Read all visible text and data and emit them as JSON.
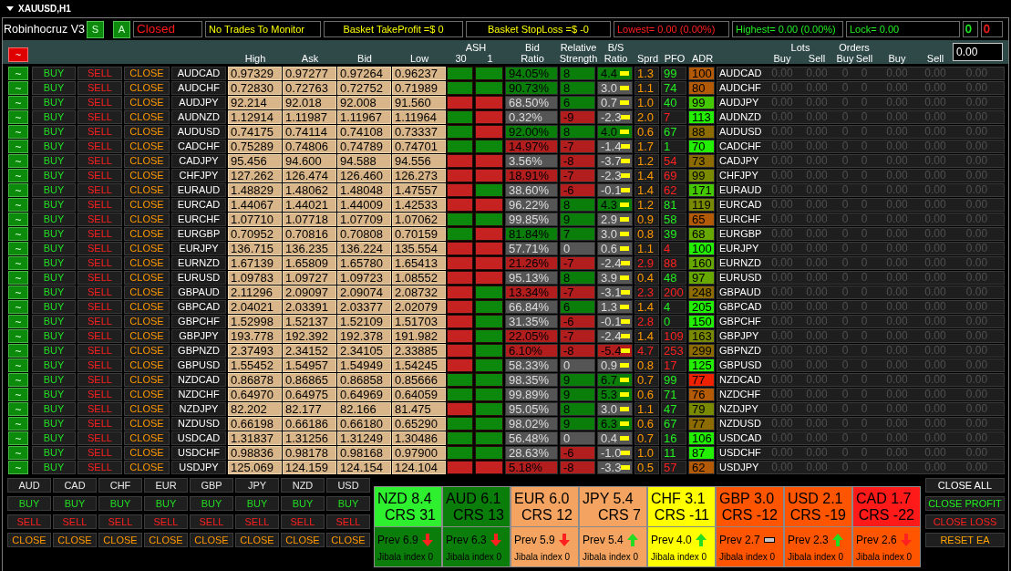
{
  "window": {
    "title": "XAUUSD,H1"
  },
  "header": {
    "title": "Robinhocruz V3",
    "mode_buttons": [
      {
        "label": "S"
      },
      {
        "label": "A"
      }
    ],
    "info": [
      {
        "kind": "status",
        "text": "Closed",
        "color": "#ff1a1a"
      },
      {
        "kind": "notice",
        "text": "No Trades To Monitor",
        "color": "#ffff00"
      },
      {
        "kind": "basket",
        "text": "Basket TakeProfit =$ 0",
        "color": "#ffff00"
      },
      {
        "kind": "basket",
        "text": "Basket StopLoss =$ -0",
        "color": "#ffff00"
      },
      {
        "kind": "stat",
        "text": "Lowest= 0.00 (0.00%)",
        "color": "#ff2020"
      },
      {
        "kind": "stat",
        "text": "Highest= 0.00 (0.00%)",
        "color": "#22ee22"
      },
      {
        "kind": "stat",
        "text": "Lock= 0.00",
        "color": "#22ee22"
      },
      {
        "kind": "counter",
        "text": "0",
        "color": "#22ee22"
      },
      {
        "kind": "counter",
        "text": "0",
        "color": "#ff2020"
      }
    ]
  },
  "columns": {
    "chart_toggle": "~",
    "high": "High",
    "ask": "Ask",
    "bid": "Bid",
    "low": "Low",
    "ash": {
      "label": "ASH",
      "periods": [
        "30",
        "1"
      ]
    },
    "bid_ratio": "Bid Ratio",
    "relative_strength": "Relative Strength",
    "bs_ratio": "B/S Ratio",
    "spread": "Sprd",
    "pfo": "PFO",
    "adr": "ADR",
    "lots": {
      "label": "Lots",
      "buy": "Buy",
      "sell": "Sell"
    },
    "orders": {
      "label": "Orders",
      "buy": "Buy",
      "sell": "Sell"
    },
    "buy": "Buy",
    "sell": "Sell",
    "input": {
      "value": "0.00"
    }
  },
  "rows": [
    {
      "chart": "~",
      "buy": "BUY",
      "sell": "SELL",
      "close": "CLOSE",
      "symbol": "AUDCAD",
      "high": "0.97329",
      "ask": "0.97277",
      "bid": "0.97264",
      "low": "0.96237",
      "ash_30": {
        "color": "#0c880c"
      },
      "ash_1": {
        "color": "#0c880c"
      },
      "bid_ratio": {
        "text": "94.05%",
        "color": "#0b7d0b"
      },
      "relative_strength": {
        "text": "8",
        "color": "#0b7d0b"
      },
      "bs_ratio": {
        "text": "4.4",
        "color": "#0b7d0b"
      },
      "spread": {
        "text": "1.3",
        "kind": "normal"
      },
      "pfo": {
        "text": "99",
        "kind": "positive"
      },
      "adr": {
        "text": "100",
        "color": "#b35a06"
      },
      "symbol_2": "AUDCAD",
      "positions": [
        "0.00",
        "0.00",
        "0",
        "0",
        "0.00",
        "0.00",
        "0.00"
      ]
    },
    {
      "chart": "~",
      "buy": "BUY",
      "sell": "SELL",
      "close": "CLOSE",
      "symbol": "AUDCHF",
      "high": "0.72830",
      "ask": "0.72763",
      "bid": "0.72752",
      "low": "0.71989",
      "ash_30": {
        "color": "#0c880c"
      },
      "ash_1": {
        "color": "#0c880c"
      },
      "bid_ratio": {
        "text": "90.73%",
        "color": "#0b7d0b"
      },
      "relative_strength": {
        "text": "8",
        "color": "#0b7d0b"
      },
      "bs_ratio": {
        "text": "3.0",
        "color": "#555555"
      },
      "spread": {
        "text": "1.1",
        "kind": "normal"
      },
      "pfo": {
        "text": "74",
        "kind": "positive"
      },
      "adr": {
        "text": "80",
        "color": "#b35a06"
      },
      "symbol_2": "AUDCHF",
      "positions": [
        "0.00",
        "0.00",
        "0",
        "0",
        "0.00",
        "0.00",
        "0.00"
      ]
    },
    {
      "chart": "~",
      "buy": "BUY",
      "sell": "SELL",
      "close": "CLOSE",
      "symbol": "AUDJPY",
      "high": "92.214",
      "ask": "92.018",
      "bid": "92.008",
      "low": "91.560",
      "ash_30": {
        "color": "#c62222"
      },
      "ash_1": {
        "color": "#c62222"
      },
      "bid_ratio": {
        "text": "68.50%",
        "color": "#555555"
      },
      "relative_strength": {
        "text": "6",
        "color": "#0b7d0b"
      },
      "bs_ratio": {
        "text": "0.7",
        "color": "#555555"
      },
      "spread": {
        "text": "1.0",
        "kind": "normal"
      },
      "pfo": {
        "text": "40",
        "kind": "positive"
      },
      "adr": {
        "text": "99",
        "color": "#44c800"
      },
      "symbol_2": "AUDJPY",
      "positions": [
        "0.00",
        "0.00",
        "0",
        "0",
        "0.00",
        "0.00",
        "0.00"
      ]
    },
    {
      "chart": "~",
      "buy": "BUY",
      "sell": "SELL",
      "close": "CLOSE",
      "symbol": "AUDNZD",
      "high": "1.12914",
      "ask": "1.11987",
      "bid": "1.11967",
      "low": "1.11964",
      "ash_30": {
        "color": "#0c880c"
      },
      "ash_1": {
        "color": "#c62222"
      },
      "bid_ratio": {
        "text": "0.32%",
        "color": "#555555"
      },
      "relative_strength": {
        "text": "-9",
        "color": "#b21e1e"
      },
      "bs_ratio": {
        "text": "-2.3",
        "color": "#555555"
      },
      "spread": {
        "text": "2.0",
        "kind": "normal"
      },
      "pfo": {
        "text": "7",
        "kind": "negative"
      },
      "adr": {
        "text": "113",
        "color": "#22f000"
      },
      "symbol_2": "AUDNZD",
      "positions": [
        "0.00",
        "0.00",
        "0",
        "0",
        "0.00",
        "0.00",
        "0.00"
      ]
    },
    {
      "chart": "~",
      "buy": "BUY",
      "sell": "SELL",
      "close": "CLOSE",
      "symbol": "AUDUSD",
      "high": "0.74175",
      "ask": "0.74114",
      "bid": "0.74108",
      "low": "0.73337",
      "ash_30": {
        "color": "#0c880c"
      },
      "ash_1": {
        "color": "#c62222"
      },
      "bid_ratio": {
        "text": "92.00%",
        "color": "#0b7d0b"
      },
      "relative_strength": {
        "text": "8",
        "color": "#0b7d0b"
      },
      "bs_ratio": {
        "text": "4.0",
        "color": "#0b7d0b"
      },
      "spread": {
        "text": "0.6",
        "kind": "normal"
      },
      "pfo": {
        "text": "67",
        "kind": "positive"
      },
      "adr": {
        "text": "88",
        "color": "#8c6c00"
      },
      "symbol_2": "AUDUSD",
      "positions": [
        "0.00",
        "0.00",
        "0",
        "0",
        "0.00",
        "0.00",
        "0.00"
      ]
    },
    {
      "chart": "~",
      "buy": "BUY",
      "sell": "SELL",
      "close": "CLOSE",
      "symbol": "CADCHF",
      "high": "0.75289",
      "ask": "0.74806",
      "bid": "0.74789",
      "low": "0.74701",
      "ash_30": {
        "color": "#0c880c"
      },
      "ash_1": {
        "color": "#0c880c"
      },
      "bid_ratio": {
        "text": "14.97%",
        "color": "#b21e1e"
      },
      "relative_strength": {
        "text": "-7",
        "color": "#b21e1e"
      },
      "bs_ratio": {
        "text": "-1.4",
        "color": "#555555"
      },
      "spread": {
        "text": "1.7",
        "kind": "normal"
      },
      "pfo": {
        "text": "1",
        "kind": "positive"
      },
      "adr": {
        "text": "70",
        "color": "#22f000"
      },
      "symbol_2": "CADCHF",
      "positions": [
        "0.00",
        "0.00",
        "0",
        "0",
        "0.00",
        "0.00",
        "0.00"
      ]
    },
    {
      "chart": "~",
      "buy": "BUY",
      "sell": "SELL",
      "close": "CLOSE",
      "symbol": "CADJPY",
      "high": "95.456",
      "ask": "94.600",
      "bid": "94.588",
      "low": "94.556",
      "ash_30": {
        "color": "#c62222"
      },
      "ash_1": {
        "color": "#c62222"
      },
      "bid_ratio": {
        "text": "3.56%",
        "color": "#555555"
      },
      "relative_strength": {
        "text": "-8",
        "color": "#b21e1e"
      },
      "bs_ratio": {
        "text": "-3.7",
        "color": "#555555"
      },
      "spread": {
        "text": "1.2",
        "kind": "normal"
      },
      "pfo": {
        "text": "54",
        "kind": "negative"
      },
      "adr": {
        "text": "73",
        "color": "#8c6c00"
      },
      "symbol_2": "CADJPY",
      "positions": [
        "0.00",
        "0.00",
        "0",
        "0",
        "0.00",
        "0.00",
        "0.00"
      ]
    },
    {
      "chart": "~",
      "buy": "BUY",
      "sell": "SELL",
      "close": "CLOSE",
      "symbol": "CHFJPY",
      "high": "127.262",
      "ask": "126.474",
      "bid": "126.460",
      "low": "126.273",
      "ash_30": {
        "color": "#c62222"
      },
      "ash_1": {
        "color": "#c62222"
      },
      "bid_ratio": {
        "text": "18.91%",
        "color": "#b21e1e"
      },
      "relative_strength": {
        "text": "-7",
        "color": "#b21e1e"
      },
      "bs_ratio": {
        "text": "-2.3",
        "color": "#555555"
      },
      "spread": {
        "text": "1.4",
        "kind": "normal"
      },
      "pfo": {
        "text": "69",
        "kind": "negative"
      },
      "adr": {
        "text": "99",
        "color": "#7a8a00"
      },
      "symbol_2": "CHFJPY",
      "positions": [
        "0.00",
        "0.00",
        "0",
        "0",
        "0.00",
        "0.00",
        "0.00"
      ]
    },
    {
      "chart": "~",
      "buy": "BUY",
      "sell": "SELL",
      "close": "CLOSE",
      "symbol": "EURAUD",
      "high": "1.48829",
      "ask": "1.48062",
      "bid": "1.48048",
      "low": "1.47557",
      "ash_30": {
        "color": "#c62222"
      },
      "ash_1": {
        "color": "#0c880c"
      },
      "bid_ratio": {
        "text": "38.60%",
        "color": "#555555"
      },
      "relative_strength": {
        "text": "-6",
        "color": "#b21e1e"
      },
      "bs_ratio": {
        "text": "-0.1",
        "color": "#555555"
      },
      "spread": {
        "text": "1.4",
        "kind": "normal"
      },
      "pfo": {
        "text": "62",
        "kind": "negative"
      },
      "adr": {
        "text": "171",
        "color": "#44c800"
      },
      "symbol_2": "EURAUD",
      "positions": [
        "0.00",
        "0.00",
        "0",
        "0",
        "0.00",
        "0.00",
        "0.00"
      ]
    },
    {
      "chart": "~",
      "buy": "BUY",
      "sell": "SELL",
      "close": "CLOSE",
      "symbol": "EURCAD",
      "high": "1.44067",
      "ask": "1.44021",
      "bid": "1.44009",
      "low": "1.42533",
      "ash_30": {
        "color": "#c62222"
      },
      "ash_1": {
        "color": "#c62222"
      },
      "bid_ratio": {
        "text": "96.22%",
        "color": "#555555"
      },
      "relative_strength": {
        "text": "8",
        "color": "#0b7d0b"
      },
      "bs_ratio": {
        "text": "4.3",
        "color": "#0b7d0b"
      },
      "spread": {
        "text": "1.2",
        "kind": "normal"
      },
      "pfo": {
        "text": "81",
        "kind": "positive"
      },
      "adr": {
        "text": "119",
        "color": "#7a8a00"
      },
      "symbol_2": "EURCAD",
      "positions": [
        "0.00",
        "0.00",
        "0",
        "0",
        "0.00",
        "0.00",
        "0.00"
      ]
    },
    {
      "chart": "~",
      "buy": "BUY",
      "sell": "SELL",
      "close": "CLOSE",
      "symbol": "EURCHF",
      "high": "1.07710",
      "ask": "1.07718",
      "bid": "1.07709",
      "low": "1.07062",
      "ash_30": {
        "color": "#0c880c"
      },
      "ash_1": {
        "color": "#0c880c"
      },
      "bid_ratio": {
        "text": "99.85%",
        "color": "#555555"
      },
      "relative_strength": {
        "text": "9",
        "color": "#0b7d0b"
      },
      "bs_ratio": {
        "text": "2.9",
        "color": "#555555"
      },
      "spread": {
        "text": "0.9",
        "kind": "normal"
      },
      "pfo": {
        "text": "58",
        "kind": "positive"
      },
      "adr": {
        "text": "65",
        "color": "#b35a06"
      },
      "symbol_2": "EURCHF",
      "positions": [
        "0.00",
        "0.00",
        "0",
        "0",
        "0.00",
        "0.00",
        "0.00"
      ]
    },
    {
      "chart": "~",
      "buy": "BUY",
      "sell": "SELL",
      "close": "CLOSE",
      "symbol": "EURGBP",
      "high": "0.70952",
      "ask": "0.70816",
      "bid": "0.70808",
      "low": "0.70159",
      "ash_30": {
        "color": "#0c880c"
      },
      "ash_1": {
        "color": "#c62222"
      },
      "bid_ratio": {
        "text": "81.84%",
        "color": "#0b7d0b"
      },
      "relative_strength": {
        "text": "7",
        "color": "#0b7d0b"
      },
      "bs_ratio": {
        "text": "3.0",
        "color": "#555555"
      },
      "spread": {
        "text": "0.8",
        "kind": "normal"
      },
      "pfo": {
        "text": "39",
        "kind": "positive"
      },
      "adr": {
        "text": "68",
        "color": "#66a800"
      },
      "symbol_2": "EURGBP",
      "positions": [
        "0.00",
        "0.00",
        "0",
        "0",
        "0.00",
        "0.00",
        "0.00"
      ]
    },
    {
      "chart": "~",
      "buy": "BUY",
      "sell": "SELL",
      "close": "CLOSE",
      "symbol": "EURJPY",
      "high": "136.715",
      "ask": "136.235",
      "bid": "136.224",
      "low": "135.554",
      "ash_30": {
        "color": "#c62222"
      },
      "ash_1": {
        "color": "#c62222"
      },
      "bid_ratio": {
        "text": "57.71%",
        "color": "#555555"
      },
      "relative_strength": {
        "text": "0",
        "color": "#555555"
      },
      "bs_ratio": {
        "text": "0.6",
        "color": "#555555"
      },
      "spread": {
        "text": "1.1",
        "kind": "normal"
      },
      "pfo": {
        "text": "4",
        "kind": "negative"
      },
      "adr": {
        "text": "100",
        "color": "#22f000"
      },
      "symbol_2": "EURJPY",
      "positions": [
        "0.00",
        "0.00",
        "0",
        "0",
        "0.00",
        "0.00",
        "0.00"
      ]
    },
    {
      "chart": "~",
      "buy": "BUY",
      "sell": "SELL",
      "close": "CLOSE",
      "symbol": "EURNZD",
      "high": "1.67139",
      "ask": "1.65809",
      "bid": "1.65780",
      "low": "1.65413",
      "ash_30": {
        "color": "#c62222"
      },
      "ash_1": {
        "color": "#c62222"
      },
      "bid_ratio": {
        "text": "21.26%",
        "color": "#b21e1e"
      },
      "relative_strength": {
        "text": "-7",
        "color": "#b21e1e"
      },
      "bs_ratio": {
        "text": "-2.4",
        "color": "#555555"
      },
      "spread": {
        "text": "2.9",
        "kind": "wide"
      },
      "pfo": {
        "text": "88",
        "kind": "negative"
      },
      "adr": {
        "text": "160",
        "color": "#66a800"
      },
      "symbol_2": "EURNZD",
      "positions": [
        "0.00",
        "0.00",
        "0",
        "0",
        "0.00",
        "0.00",
        "0.00"
      ]
    },
    {
      "chart": "~",
      "buy": "BUY",
      "sell": "SELL",
      "close": "CLOSE",
      "symbol": "EURUSD",
      "high": "1.09783",
      "ask": "1.09727",
      "bid": "1.09723",
      "low": "1.08552",
      "ash_30": {
        "color": "#c62222"
      },
      "ash_1": {
        "color": "#c62222"
      },
      "bid_ratio": {
        "text": "95.13%",
        "color": "#555555"
      },
      "relative_strength": {
        "text": "8",
        "color": "#0b7d0b"
      },
      "bs_ratio": {
        "text": "3.9",
        "color": "#555555"
      },
      "spread": {
        "text": "0.4",
        "kind": "normal"
      },
      "pfo": {
        "text": "48",
        "kind": "positive"
      },
      "adr": {
        "text": "97",
        "color": "#66a800"
      },
      "symbol_2": "EURUSD",
      "positions": [
        "0.00",
        "0.00",
        "0",
        "0",
        "0.00",
        "0.00",
        "0.00"
      ]
    },
    {
      "chart": "~",
      "buy": "BUY",
      "sell": "SELL",
      "close": "CLOSE",
      "symbol": "GBPAUD",
      "high": "2.11296",
      "ask": "2.09097",
      "bid": "2.09074",
      "low": "2.08732",
      "ash_30": {
        "color": "#c62222"
      },
      "ash_1": {
        "color": "#0c880c"
      },
      "bid_ratio": {
        "text": "13.34%",
        "color": "#b21e1e"
      },
      "relative_strength": {
        "text": "-7",
        "color": "#b21e1e"
      },
      "bs_ratio": {
        "text": "-3.1",
        "color": "#555555"
      },
      "spread": {
        "text": "2.3",
        "kind": "wide"
      },
      "pfo": {
        "text": "200",
        "kind": "negative"
      },
      "adr": {
        "text": "248",
        "color": "#8c6c00"
      },
      "symbol_2": "GBPAUD",
      "positions": [
        "0.00",
        "0.00",
        "0",
        "0",
        "0.00",
        "0.00",
        "0.00"
      ]
    },
    {
      "chart": "~",
      "buy": "BUY",
      "sell": "SELL",
      "close": "CLOSE",
      "symbol": "GBPCAD",
      "high": "2.04021",
      "ask": "2.03391",
      "bid": "2.03377",
      "low": "2.02079",
      "ash_30": {
        "color": "#c62222"
      },
      "ash_1": {
        "color": "#0c880c"
      },
      "bid_ratio": {
        "text": "66.84%",
        "color": "#555555"
      },
      "relative_strength": {
        "text": "6",
        "color": "#0b7d0b"
      },
      "bs_ratio": {
        "text": "1.3",
        "color": "#555555"
      },
      "spread": {
        "text": "1.4",
        "kind": "normal"
      },
      "pfo": {
        "text": "4",
        "kind": "positive"
      },
      "adr": {
        "text": "205",
        "color": "#22f000"
      },
      "symbol_2": "GBPCAD",
      "positions": [
        "0.00",
        "0.00",
        "0",
        "0",
        "0.00",
        "0.00",
        "0.00"
      ]
    },
    {
      "chart": "~",
      "buy": "BUY",
      "sell": "SELL",
      "close": "CLOSE",
      "symbol": "GBPCHF",
      "high": "1.52998",
      "ask": "1.52137",
      "bid": "1.52109",
      "low": "1.51703",
      "ash_30": {
        "color": "#c62222"
      },
      "ash_1": {
        "color": "#0c880c"
      },
      "bid_ratio": {
        "text": "31.35%",
        "color": "#555555"
      },
      "relative_strength": {
        "text": "-6",
        "color": "#b21e1e"
      },
      "bs_ratio": {
        "text": "-0.1",
        "color": "#555555"
      },
      "spread": {
        "text": "2.8",
        "kind": "wide"
      },
      "pfo": {
        "text": "0",
        "kind": "positive"
      },
      "adr": {
        "text": "150",
        "color": "#22f000"
      },
      "symbol_2": "GBPCHF",
      "positions": [
        "0.00",
        "0.00",
        "0",
        "0",
        "0.00",
        "0.00",
        "0.00"
      ]
    },
    {
      "chart": "~",
      "buy": "BUY",
      "sell": "SELL",
      "close": "CLOSE",
      "symbol": "GBPJPY",
      "high": "193.778",
      "ask": "192.392",
      "bid": "192.378",
      "low": "191.982",
      "ash_30": {
        "color": "#c62222"
      },
      "ash_1": {
        "color": "#0c880c"
      },
      "bid_ratio": {
        "text": "22.05%",
        "color": "#b21e1e"
      },
      "relative_strength": {
        "text": "-7",
        "color": "#b21e1e"
      },
      "bs_ratio": {
        "text": "-2.4",
        "color": "#555555"
      },
      "spread": {
        "text": "1.4",
        "kind": "normal"
      },
      "pfo": {
        "text": "109",
        "kind": "negative"
      },
      "adr": {
        "text": "163",
        "color": "#7a8a00"
      },
      "symbol_2": "GBPJPY",
      "positions": [
        "0.00",
        "0.00",
        "0",
        "0",
        "0.00",
        "0.00",
        "0.00"
      ]
    },
    {
      "chart": "~",
      "buy": "BUY",
      "sell": "SELL",
      "close": "CLOSE",
      "symbol": "GBPNZD",
      "high": "2.37493",
      "ask": "2.34152",
      "bid": "2.34105",
      "low": "2.33885",
      "ash_30": {
        "color": "#c62222"
      },
      "ash_1": {
        "color": "#0c880c"
      },
      "bid_ratio": {
        "text": "6.10%",
        "color": "#b21e1e"
      },
      "relative_strength": {
        "text": "-8",
        "color": "#b21e1e"
      },
      "bs_ratio": {
        "text": "-5.4",
        "color": "#b21e1e"
      },
      "spread": {
        "text": "4.7",
        "kind": "wide"
      },
      "pfo": {
        "text": "253",
        "kind": "negative"
      },
      "adr": {
        "text": "299",
        "color": "#8c6c00"
      },
      "symbol_2": "GBPNZD",
      "positions": [
        "0.00",
        "0.00",
        "0",
        "0",
        "0.00",
        "0.00",
        "0.00"
      ]
    },
    {
      "chart": "~",
      "buy": "BUY",
      "sell": "SELL",
      "close": "CLOSE",
      "symbol": "GBPUSD",
      "high": "1.55452",
      "ask": "1.54957",
      "bid": "1.54949",
      "low": "1.54245",
      "ash_30": {
        "color": "#c62222"
      },
      "ash_1": {
        "color": "#0c880c"
      },
      "bid_ratio": {
        "text": "58.33%",
        "color": "#555555"
      },
      "relative_strength": {
        "text": "0",
        "color": "#555555"
      },
      "bs_ratio": {
        "text": "0.9",
        "color": "#555555"
      },
      "spread": {
        "text": "0.8",
        "kind": "normal"
      },
      "pfo": {
        "text": "17",
        "kind": "negative"
      },
      "adr": {
        "text": "125",
        "color": "#22f000"
      },
      "symbol_2": "GBPUSD",
      "positions": [
        "0.00",
        "0.00",
        "0",
        "0",
        "0.00",
        "0.00",
        "0.00"
      ]
    },
    {
      "chart": "~",
      "buy": "BUY",
      "sell": "SELL",
      "close": "CLOSE",
      "symbol": "NZDCAD",
      "high": "0.86878",
      "ask": "0.86865",
      "bid": "0.86858",
      "low": "0.85666",
      "ash_30": {
        "color": "#0c880c"
      },
      "ash_1": {
        "color": "#0c880c"
      },
      "bid_ratio": {
        "text": "98.35%",
        "color": "#555555"
      },
      "relative_strength": {
        "text": "9",
        "color": "#0b7d0b"
      },
      "bs_ratio": {
        "text": "6.7",
        "color": "#0b7d0b"
      },
      "spread": {
        "text": "0.7",
        "kind": "normal"
      },
      "pfo": {
        "text": "99",
        "kind": "positive"
      },
      "adr": {
        "text": "77",
        "color": "#ee2200"
      },
      "symbol_2": "NZDCAD",
      "positions": [
        "0.00",
        "0.00",
        "0",
        "0",
        "0.00",
        "0.00",
        "0.00"
      ]
    },
    {
      "chart": "~",
      "buy": "BUY",
      "sell": "SELL",
      "close": "CLOSE",
      "symbol": "NZDCHF",
      "high": "0.64970",
      "ask": "0.64975",
      "bid": "0.64969",
      "low": "0.64059",
      "ash_30": {
        "color": "#0c880c"
      },
      "ash_1": {
        "color": "#0c880c"
      },
      "bid_ratio": {
        "text": "99.89%",
        "color": "#555555"
      },
      "relative_strength": {
        "text": "9",
        "color": "#0b7d0b"
      },
      "bs_ratio": {
        "text": "5.3",
        "color": "#0b7d0b"
      },
      "spread": {
        "text": "0.6",
        "kind": "normal"
      },
      "pfo": {
        "text": "71",
        "kind": "positive"
      },
      "adr": {
        "text": "76",
        "color": "#b35a06"
      },
      "symbol_2": "NZDCHF",
      "positions": [
        "0.00",
        "0.00",
        "0",
        "0",
        "0.00",
        "0.00",
        "0.00"
      ]
    },
    {
      "chart": "~",
      "buy": "BUY",
      "sell": "SELL",
      "close": "CLOSE",
      "symbol": "NZDJPY",
      "high": "82.202",
      "ask": "82.177",
      "bid": "82.166",
      "low": "81.475",
      "ash_30": {
        "color": "#c62222"
      },
      "ash_1": {
        "color": "#0c880c"
      },
      "bid_ratio": {
        "text": "95.05%",
        "color": "#555555"
      },
      "relative_strength": {
        "text": "8",
        "color": "#0b7d0b"
      },
      "bs_ratio": {
        "text": "3.0",
        "color": "#555555"
      },
      "spread": {
        "text": "1.1",
        "kind": "normal"
      },
      "pfo": {
        "text": "47",
        "kind": "positive"
      },
      "adr": {
        "text": "79",
        "color": "#7a8a00"
      },
      "symbol_2": "NZDJPY",
      "positions": [
        "0.00",
        "0.00",
        "0",
        "0",
        "0.00",
        "0.00",
        "0.00"
      ]
    },
    {
      "chart": "~",
      "buy": "BUY",
      "sell": "SELL",
      "close": "CLOSE",
      "symbol": "NZDUSD",
      "high": "0.66198",
      "ask": "0.66186",
      "bid": "0.66180",
      "low": "0.65290",
      "ash_30": {
        "color": "#0c880c"
      },
      "ash_1": {
        "color": "#0c880c"
      },
      "bid_ratio": {
        "text": "98.02%",
        "color": "#555555"
      },
      "relative_strength": {
        "text": "9",
        "color": "#0b7d0b"
      },
      "bs_ratio": {
        "text": "6.3",
        "color": "#0b7d0b"
      },
      "spread": {
        "text": "0.6",
        "kind": "normal"
      },
      "pfo": {
        "text": "67",
        "kind": "positive"
      },
      "adr": {
        "text": "77",
        "color": "#8c6c00"
      },
      "symbol_2": "NZDUSD",
      "positions": [
        "0.00",
        "0.00",
        "0",
        "0",
        "0.00",
        "0.00",
        "0.00"
      ]
    },
    {
      "chart": "~",
      "buy": "BUY",
      "sell": "SELL",
      "close": "CLOSE",
      "symbol": "USDCAD",
      "high": "1.31837",
      "ask": "1.31256",
      "bid": "1.31249",
      "low": "1.30486",
      "ash_30": {
        "color": "#0c880c"
      },
      "ash_1": {
        "color": "#0c880c"
      },
      "bid_ratio": {
        "text": "56.48%",
        "color": "#555555"
      },
      "relative_strength": {
        "text": "0",
        "color": "#555555"
      },
      "bs_ratio": {
        "text": "0.4",
        "color": "#555555"
      },
      "spread": {
        "text": "0.7",
        "kind": "normal"
      },
      "pfo": {
        "text": "16",
        "kind": "positive"
      },
      "adr": {
        "text": "106",
        "color": "#22f000"
      },
      "symbol_2": "USDCAD",
      "positions": [
        "0.00",
        "0.00",
        "0",
        "0",
        "0.00",
        "0.00",
        "0.00"
      ]
    },
    {
      "chart": "~",
      "buy": "BUY",
      "sell": "SELL",
      "close": "CLOSE",
      "symbol": "USDCHF",
      "high": "0.98836",
      "ask": "0.98178",
      "bid": "0.98168",
      "low": "0.97900",
      "ash_30": {
        "color": "#0c880c"
      },
      "ash_1": {
        "color": "#0c880c"
      },
      "bid_ratio": {
        "text": "28.63%",
        "color": "#555555"
      },
      "relative_strength": {
        "text": "-6",
        "color": "#b21e1e"
      },
      "bs_ratio": {
        "text": "-1.0",
        "color": "#555555"
      },
      "spread": {
        "text": "1.0",
        "kind": "normal"
      },
      "pfo": {
        "text": "11",
        "kind": "positive"
      },
      "adr": {
        "text": "87",
        "color": "#22f000"
      },
      "symbol_2": "USDCHF",
      "positions": [
        "0.00",
        "0.00",
        "0",
        "0",
        "0.00",
        "0.00",
        "0.00"
      ]
    },
    {
      "chart": "~",
      "buy": "BUY",
      "sell": "SELL",
      "close": "CLOSE",
      "symbol": "USDJPY",
      "high": "125.069",
      "ask": "124.159",
      "bid": "124.154",
      "low": "124.104",
      "ash_30": {
        "color": "#c62222"
      },
      "ash_1": {
        "color": "#c62222"
      },
      "bid_ratio": {
        "text": "5.18%",
        "color": "#b21e1e"
      },
      "relative_strength": {
        "text": "-8",
        "color": "#b21e1e"
      },
      "bs_ratio": {
        "text": "-3.3",
        "color": "#555555"
      },
      "spread": {
        "text": "0.5",
        "kind": "normal"
      },
      "pfo": {
        "text": "57",
        "kind": "negative"
      },
      "adr": {
        "text": "62",
        "color": "#b35a06"
      },
      "symbol_2": "USDJPY",
      "positions": [
        "0.00",
        "0.00",
        "0",
        "0",
        "0.00",
        "0.00",
        "0.00"
      ]
    }
  ],
  "currency_buttons": [
    {
      "currency": "AUD",
      "buy": "BUY",
      "sell": "SELL",
      "close": "CLOSE"
    },
    {
      "currency": "CAD",
      "buy": "BUY",
      "sell": "SELL",
      "close": "CLOSE"
    },
    {
      "currency": "CHF",
      "buy": "BUY",
      "sell": "SELL",
      "close": "CLOSE"
    },
    {
      "currency": "EUR",
      "buy": "BUY",
      "sell": "SELL",
      "close": "CLOSE"
    },
    {
      "currency": "GBP",
      "buy": "BUY",
      "sell": "SELL",
      "close": "CLOSE"
    },
    {
      "currency": "JPY",
      "buy": "BUY",
      "sell": "SELL",
      "close": "CLOSE"
    },
    {
      "currency": "NZD",
      "buy": "BUY",
      "sell": "SELL",
      "close": "CLOSE"
    },
    {
      "currency": "USD",
      "buy": "BUY",
      "sell": "SELL",
      "close": "CLOSE"
    }
  ],
  "strength": [
    {
      "title": "NZD 8.4",
      "crs": "CRS 31",
      "color": "#2ff02f",
      "prev": {
        "text": "Prev 6.9",
        "kind": "down",
        "color": "#0b7d0b"
      },
      "index": "Jibala index 0"
    },
    {
      "title": "AUD 6.1",
      "crs": "CRS 13",
      "color": "#0b7d0b",
      "prev": {
        "text": "Prev 6.3",
        "kind": "down",
        "color": "#0b7d0b"
      },
      "index": "Jibala index 0"
    },
    {
      "title": "EUR 6.0",
      "crs": "CRS 12",
      "color": "#f4a460",
      "prev": {
        "text": "Prev 5.9",
        "kind": "down",
        "color": "#f4a460"
      },
      "index": "Jibala index 0"
    },
    {
      "title": "JPY 5.4",
      "crs": "CRS 7",
      "color": "#f4a460",
      "prev": {
        "text": "Prev 5.4",
        "kind": "up",
        "color": "#f4a460"
      },
      "index": "Jibala index 0"
    },
    {
      "title": "CHF 3.1",
      "crs": "CRS -11",
      "color": "#ffff00",
      "prev": {
        "text": "Prev 4.0",
        "kind": "up",
        "color": "#ffff00"
      },
      "index": "Jibala index 0"
    },
    {
      "title": "GBP 3.0",
      "crs": "CRS -12",
      "color": "#ff5500",
      "prev": {
        "text": "Prev 2.7",
        "kind": "flat",
        "color": "#ff5500"
      },
      "index": "Jibala index 0"
    },
    {
      "title": "USD 2.1",
      "crs": "CRS -19",
      "color": "#ff5500",
      "prev": {
        "text": "Prev 2.3",
        "kind": "up",
        "color": "#ff5500"
      },
      "index": "Jibala index 0"
    },
    {
      "title": "CAD 1.7",
      "crs": "CRS -22",
      "color": "#ff1a1a",
      "prev": {
        "text": "Prev 2.6",
        "kind": "down",
        "color": "#ff5500"
      },
      "index": "Jibala index 0"
    }
  ],
  "actions": [
    {
      "label": "CLOSE ALL",
      "kind": "close_all"
    },
    {
      "label": "CLOSE PROFIT",
      "kind": "close_profit"
    },
    {
      "label": "CLOSE LOSS",
      "kind": "close_loss"
    },
    {
      "label": "RESET EA",
      "kind": "reset"
    }
  ]
}
